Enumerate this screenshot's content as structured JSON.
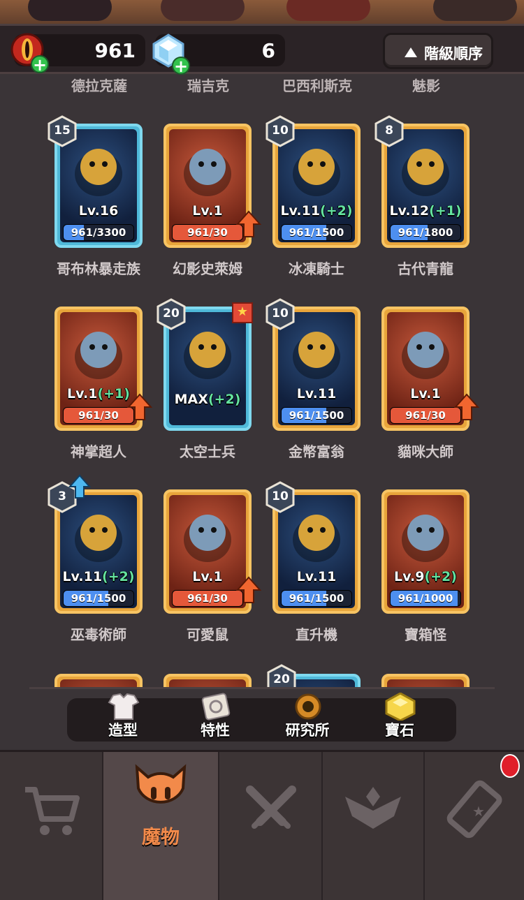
{
  "resources": {
    "gold": {
      "value": "961",
      "icon": "red-gem-icon"
    },
    "gem": {
      "value": "6",
      "icon": "crystal-icon"
    }
  },
  "sort_button": {
    "label": "階級順序",
    "icon": "triangle-up-icon"
  },
  "cut_row_names": [
    "德拉克薩",
    "瑞吉克",
    "巴西利斯克",
    "魅影"
  ],
  "monsters": [
    {
      "name": "哥布林暴走族",
      "level": "Lv.16",
      "bonus": "",
      "progress": "961/3300",
      "progress_value": 0.29,
      "badge": "15",
      "frame": "blue",
      "bg": "night",
      "upgrade": false
    },
    {
      "name": "幻影史萊姆",
      "level": "Lv.1",
      "bonus": "",
      "progress": "961/30",
      "progress_value": 1.0,
      "badge": "",
      "frame": "gold",
      "bg": "red",
      "upgrade": true
    },
    {
      "name": "冰凍騎士",
      "level": "Lv.11",
      "bonus": "(+2)",
      "progress": "961/1500",
      "progress_value": 0.64,
      "badge": "10",
      "frame": "gold",
      "bg": "night",
      "upgrade": false
    },
    {
      "name": "古代青龍",
      "level": "Lv.12",
      "bonus": "(+1)",
      "progress": "961/1800",
      "progress_value": 0.53,
      "badge": "8",
      "frame": "gold",
      "bg": "night",
      "upgrade": false
    },
    {
      "name": "神掌超人",
      "level": "Lv.1",
      "bonus": "(+1)",
      "progress": "961/30",
      "progress_value": 1.0,
      "badge": "",
      "frame": "gold",
      "bg": "red",
      "upgrade": true
    },
    {
      "name": "太空士兵",
      "level": "MAX",
      "bonus": "(+2)",
      "progress": "",
      "progress_value": 0,
      "badge": "20",
      "frame": "blue",
      "bg": "night",
      "upgrade": false,
      "star": true
    },
    {
      "name": "金幣富翁",
      "level": "Lv.11",
      "bonus": "",
      "progress": "961/1500",
      "progress_value": 0.64,
      "badge": "10",
      "frame": "gold",
      "bg": "night",
      "upgrade": false
    },
    {
      "name": "貓咪大師",
      "level": "Lv.1",
      "bonus": "",
      "progress": "961/30",
      "progress_value": 1.0,
      "badge": "",
      "frame": "gold",
      "bg": "red",
      "upgrade": true
    },
    {
      "name": "巫毒術師",
      "level": "Lv.11",
      "bonus": "(+2)",
      "progress": "961/1500",
      "progress_value": 0.64,
      "badge": "3",
      "frame": "gold",
      "bg": "night",
      "upgrade": false,
      "badge_up": true
    },
    {
      "name": "可愛鼠",
      "level": "Lv.1",
      "bonus": "",
      "progress": "961/30",
      "progress_value": 1.0,
      "badge": "",
      "frame": "gold",
      "bg": "red",
      "upgrade": true
    },
    {
      "name": "直升機",
      "level": "Lv.11",
      "bonus": "",
      "progress": "961/1500",
      "progress_value": 0.64,
      "badge": "10",
      "frame": "gold",
      "bg": "night",
      "upgrade": false
    },
    {
      "name": "寶箱怪",
      "level": "Lv.9",
      "bonus": "(+2)",
      "progress": "961/1000",
      "progress_value": 0.96,
      "badge": "",
      "frame": "gold",
      "bg": "red",
      "upgrade": false
    }
  ],
  "partial_row": {
    "badge": "20"
  },
  "feature_bar": [
    {
      "label": "造型",
      "icon": "shirt-icon"
    },
    {
      "label": "特性",
      "icon": "scroll-icon"
    },
    {
      "label": "研究所",
      "icon": "gear-lab-icon"
    },
    {
      "label": "寶石",
      "icon": "gem-icon"
    }
  ],
  "nav": [
    {
      "label": "",
      "icon": "cart-icon",
      "active": false
    },
    {
      "label": "魔物",
      "icon": "monster-icon",
      "active": true
    },
    {
      "label": "",
      "icon": "crossed-swords-icon",
      "active": false
    },
    {
      "label": "",
      "icon": "rank-wings-icon",
      "active": false
    },
    {
      "label": "",
      "icon": "ticket-icon",
      "active": false,
      "notification": true
    }
  ],
  "colors": {
    "accent": "#f28a4a",
    "gold_frame": "#e8a53b",
    "blue_frame": "#4fb9d9",
    "bonus_green": "#64e3a0"
  }
}
